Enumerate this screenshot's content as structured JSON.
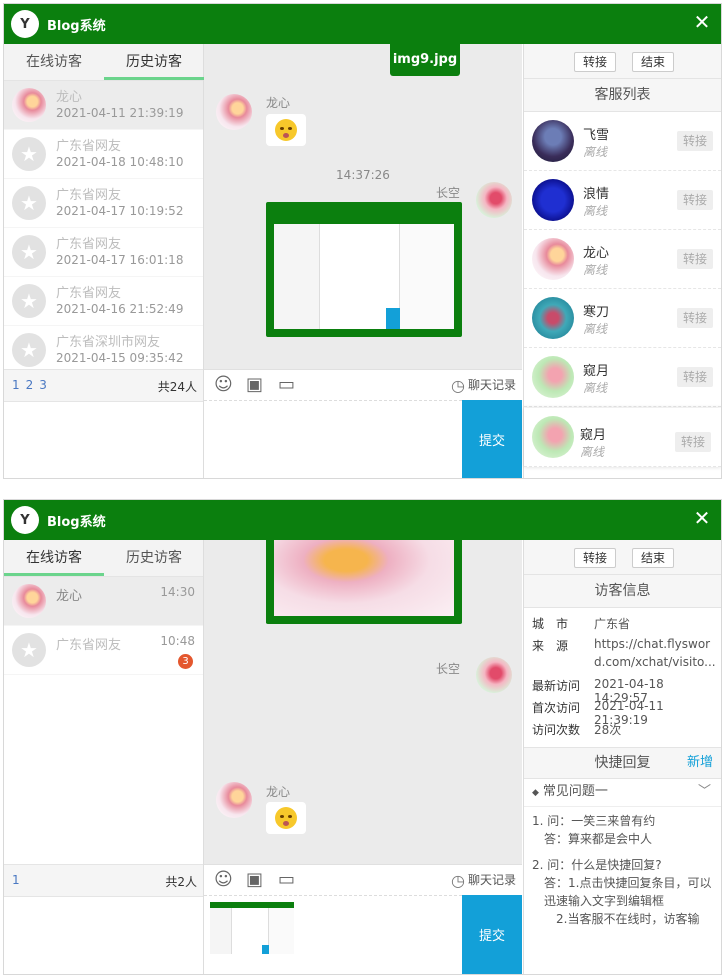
{
  "colors": {
    "titlebar": "#0b7f0e",
    "submit": "#13a0d8",
    "tab_active": "#6bd48c",
    "badge": "#e4572e"
  },
  "w1": {
    "app_title": "Blog系统",
    "tabs": [
      "在线访客",
      "历史访客"
    ],
    "visitors": [
      {
        "name": "龙心",
        "time": "2021-04-11 21:39:19"
      },
      {
        "name": "广东省网友",
        "time": "2021-04-18 10:48:10"
      },
      {
        "name": "广东省网友",
        "time": "2021-04-17 10:19:52"
      },
      {
        "name": "广东省网友",
        "time": "2021-04-17 16:01:18"
      },
      {
        "name": "广东省网友",
        "time": "2021-04-16 21:52:49"
      },
      {
        "name": "广东省深圳市网友",
        "time": "2021-04-15 09:35:42"
      }
    ],
    "pages": [
      "1",
      "2",
      "3"
    ],
    "total": "共24人",
    "chat": {
      "image_name": "img9.jpg",
      "visitor_name": "龙心",
      "timestamp": "14:37:26",
      "agent_name": "长空"
    },
    "history_link": "聊天记录",
    "submit": "提交",
    "buttons": {
      "transfer": "转接",
      "end": "结束"
    },
    "agents_header": "客服列表",
    "agents": [
      {
        "name": "飞雪",
        "status": "离线",
        "btn": "转接"
      },
      {
        "name": "浪情",
        "status": "离线",
        "btn": "转接"
      },
      {
        "name": "龙心",
        "status": "离线",
        "btn": "转接"
      },
      {
        "name": "寒刀",
        "status": "离线",
        "btn": "转接"
      },
      {
        "name": "窥月",
        "status": "离线",
        "btn": "转接"
      },
      {
        "name": "窥月",
        "status": "离线",
        "btn": "转接"
      }
    ]
  },
  "w2": {
    "app_title": "Blog系统",
    "tabs": [
      "在线访客",
      "历史访客"
    ],
    "visitors": [
      {
        "name": "龙心",
        "time": "14:30"
      },
      {
        "name": "广东省网友",
        "time": "10:48",
        "badge": "3"
      }
    ],
    "page": "1",
    "total": "共2人",
    "chat": {
      "agent_name": "长空",
      "visitor_name": "龙心"
    },
    "history_link": "聊天记录",
    "submit": "提交",
    "buttons": {
      "transfer": "转接",
      "end": "结束"
    },
    "info_header": "访客信息",
    "info": [
      {
        "k": "城　市",
        "v": "广东省"
      },
      {
        "k": "来　源",
        "v": "https://chat.flysword.com/xchat/visito..."
      },
      {
        "k": "最新访问",
        "v": "2021-04-18 14:29:57"
      },
      {
        "k": "首次访问",
        "v": "2021-04-11 21:39:19"
      },
      {
        "k": "访问次数",
        "v": "28次"
      }
    ],
    "quick_header": "快捷回复",
    "quick_add": "新增",
    "quick_category": "常见问题一",
    "quick_items": [
      "1. 问：一笑三来曾有约",
      "答：算来都是会中人",
      "2. 问：什么是快捷回复?",
      "答：1.点击快捷回复条目，可以迅速输入文字到编辑框",
      "2.当客服不在线时，访客输"
    ]
  }
}
